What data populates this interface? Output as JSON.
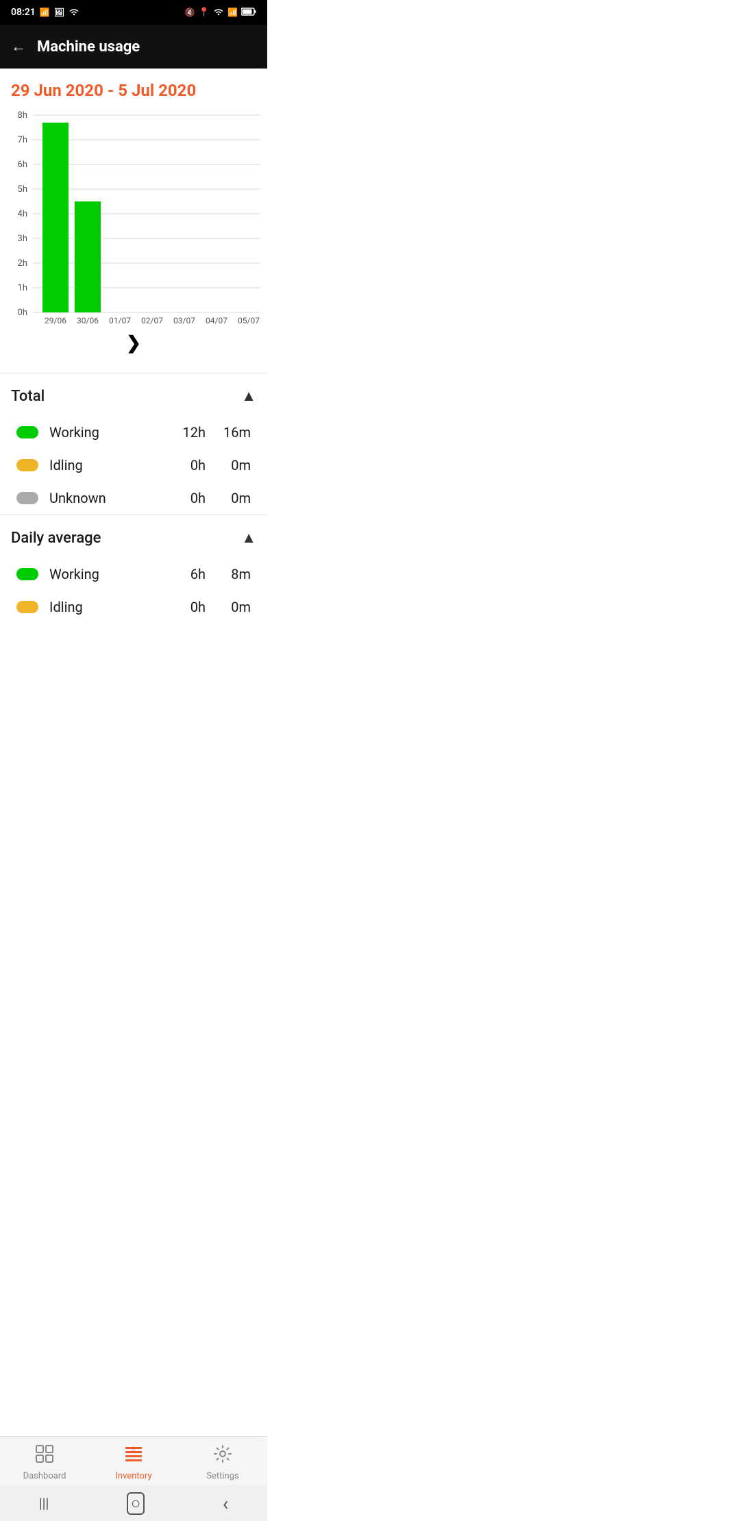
{
  "statusBar": {
    "time": "08:21",
    "rightIcons": [
      "mute",
      "location",
      "wifi",
      "signal",
      "battery"
    ]
  },
  "header": {
    "backLabel": "←",
    "title": "Machine usage"
  },
  "dateRange": "29 Jun 2020 - 5 Jul 2020",
  "chart": {
    "yLabels": [
      "8h",
      "7h",
      "6h",
      "5h",
      "4h",
      "3h",
      "2h",
      "1h",
      "0h"
    ],
    "xLabels": [
      "29/06",
      "30/06",
      "01/07",
      "02/07",
      "03/07",
      "04/07",
      "05/07"
    ],
    "bars": [
      {
        "date": "29/06",
        "value": 7.7
      },
      {
        "date": "30/06",
        "value": 4.5
      },
      {
        "date": "01/07",
        "value": 0
      },
      {
        "date": "02/07",
        "value": 0
      },
      {
        "date": "03/07",
        "value": 0
      },
      {
        "date": "04/07",
        "value": 0
      },
      {
        "date": "05/07",
        "value": 0
      }
    ],
    "maxValue": 8,
    "barColor": "#00cc00",
    "nextArrow": "❯"
  },
  "totalSection": {
    "title": "Total",
    "collapseIcon": "▲",
    "rows": [
      {
        "label": "Working",
        "color": "#00cc00",
        "hours": "12h",
        "minutes": "16m"
      },
      {
        "label": "Idling",
        "color": "#f0b429",
        "hours": "0h",
        "minutes": "0m"
      },
      {
        "label": "Unknown",
        "color": "#aaa",
        "hours": "0h",
        "minutes": "0m"
      }
    ]
  },
  "dailyAverageSection": {
    "title": "Daily average",
    "collapseIcon": "▲",
    "rows": [
      {
        "label": "Working",
        "color": "#00cc00",
        "hours": "6h",
        "minutes": "8m"
      },
      {
        "label": "Idling",
        "color": "#f0b429",
        "hours": "0h",
        "minutes": "0m"
      }
    ]
  },
  "bottomNav": {
    "items": [
      {
        "id": "dashboard",
        "label": "Dashboard",
        "active": false
      },
      {
        "id": "inventory",
        "label": "Inventory",
        "active": true
      },
      {
        "id": "settings",
        "label": "Settings",
        "active": false
      }
    ]
  },
  "androidNav": {
    "menu": "|||",
    "home": "○",
    "back": "‹"
  }
}
